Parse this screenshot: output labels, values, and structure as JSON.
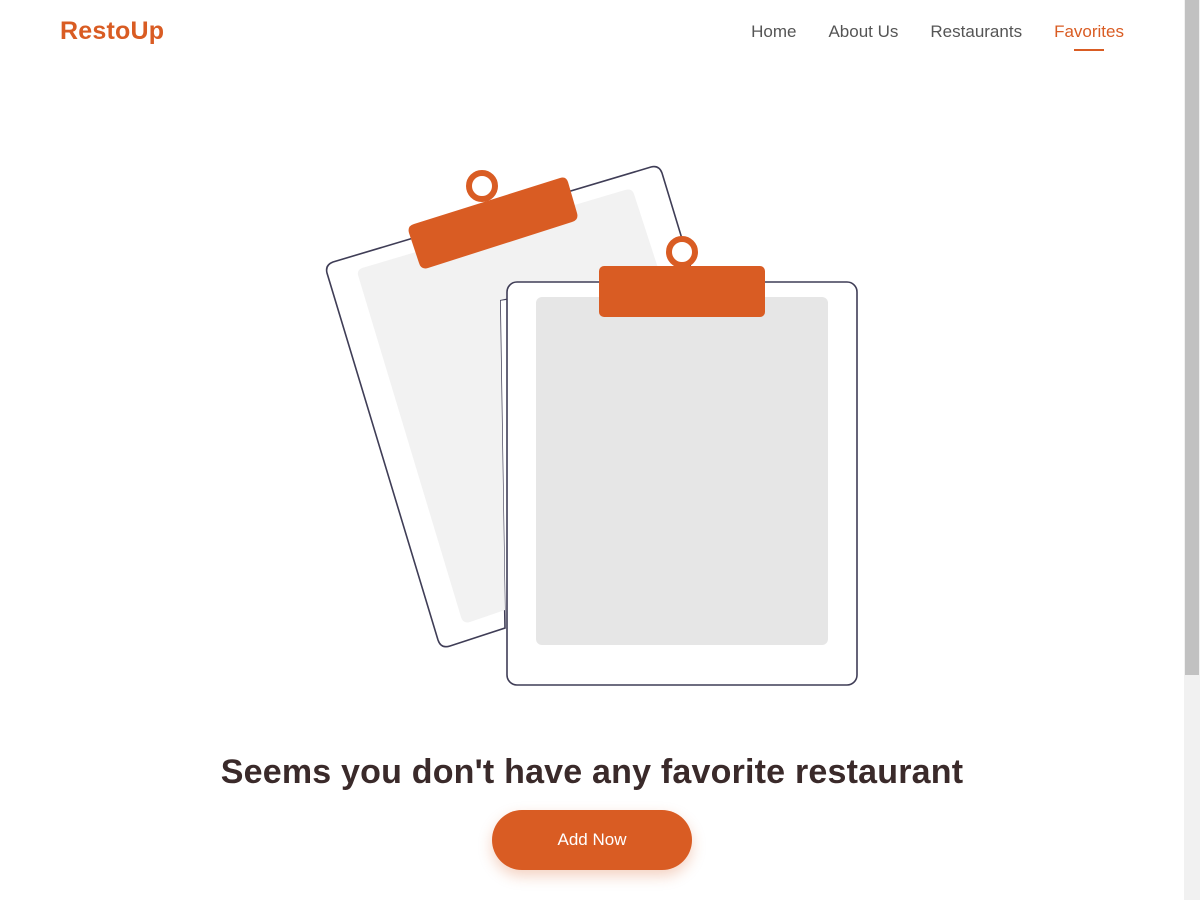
{
  "header": {
    "logo": "RestoUp",
    "nav": [
      {
        "label": "Home",
        "active": false
      },
      {
        "label": "About Us",
        "active": false
      },
      {
        "label": "Restaurants",
        "active": false
      },
      {
        "label": "Favorites",
        "active": true
      }
    ]
  },
  "main": {
    "illustration_icon": "empty-clipboard-icon",
    "message": "Seems you don't have any favorite restaurant",
    "button_label": "Add Now"
  },
  "colors": {
    "accent": "#d95c23",
    "heading": "#3a2a2a",
    "nav_text": "#555555",
    "paper_back": "#f2f2f2",
    "paper_front": "#e6e6e6",
    "outline": "#3f3d56"
  }
}
